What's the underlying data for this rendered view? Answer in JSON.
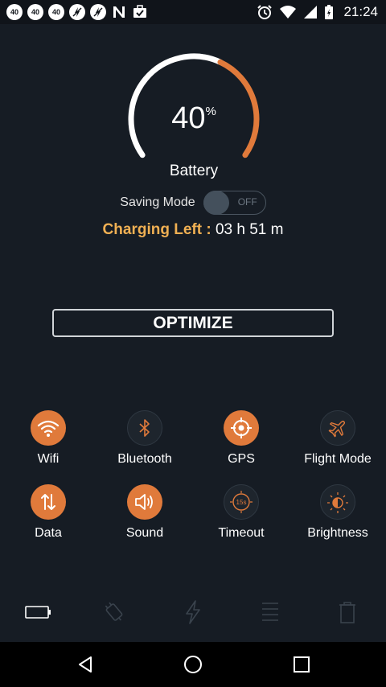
{
  "statusbar": {
    "badges": [
      "40",
      "40",
      "40"
    ],
    "time": "21:24",
    "icons": [
      "sync-off-icon",
      "sync-off-icon",
      "n-icon",
      "briefcase-icon",
      "alarm-icon",
      "wifi-icon",
      "signal-icon",
      "battery-charging-icon"
    ]
  },
  "battery": {
    "percent": 40,
    "percent_text": "40",
    "percent_sign": "%",
    "label": "Battery"
  },
  "saving_mode": {
    "label": "Saving Mode",
    "state": "OFF"
  },
  "charging": {
    "label": "Charging Left :",
    "value": "03 h 51 m"
  },
  "optimize": {
    "label": "OPTIMIZE"
  },
  "quick_toggles": [
    {
      "label": "Wifi",
      "icon": "wifi-icon",
      "active": true
    },
    {
      "label": "Bluetooth",
      "icon": "bluetooth-icon",
      "active": false
    },
    {
      "label": "GPS",
      "icon": "gps-icon",
      "active": true
    },
    {
      "label": "Flight Mode",
      "icon": "airplane-icon",
      "active": false
    },
    {
      "label": "Data",
      "icon": "data-arrows-icon",
      "active": true
    },
    {
      "label": "Sound",
      "icon": "speaker-icon",
      "active": true
    },
    {
      "label": "Timeout",
      "icon": "timer-icon",
      "active": false,
      "timer_text": "15s"
    },
    {
      "label": "Brightness",
      "icon": "brightness-icon",
      "active": false
    }
  ],
  "bottom_tabs": [
    "battery-tab-icon",
    "charge-tab-icon",
    "boost-tab-icon",
    "list-tab-icon",
    "trash-tab-icon"
  ],
  "colors": {
    "accent": "#e07a3b",
    "charging_label": "#f0b053",
    "background": "#161c24"
  }
}
